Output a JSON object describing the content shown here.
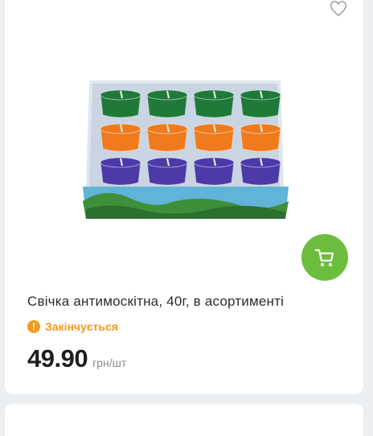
{
  "product": {
    "title": "Свічка антимоскітна, 40г, в асортименті",
    "stock_status": "Закінчується",
    "stock_icon_text": "!",
    "price": "49.90",
    "unit": "грн/шт"
  },
  "icons": {
    "favorite": "heart-icon",
    "cart": "shopping-cart-icon",
    "stock": "warning-icon"
  },
  "colors": {
    "accent_green": "#6cbd3e",
    "warning_orange": "#f39a1e",
    "candle_green": "#1f7a3a",
    "candle_orange": "#f07a1c",
    "candle_purple": "#4b3aa8"
  }
}
